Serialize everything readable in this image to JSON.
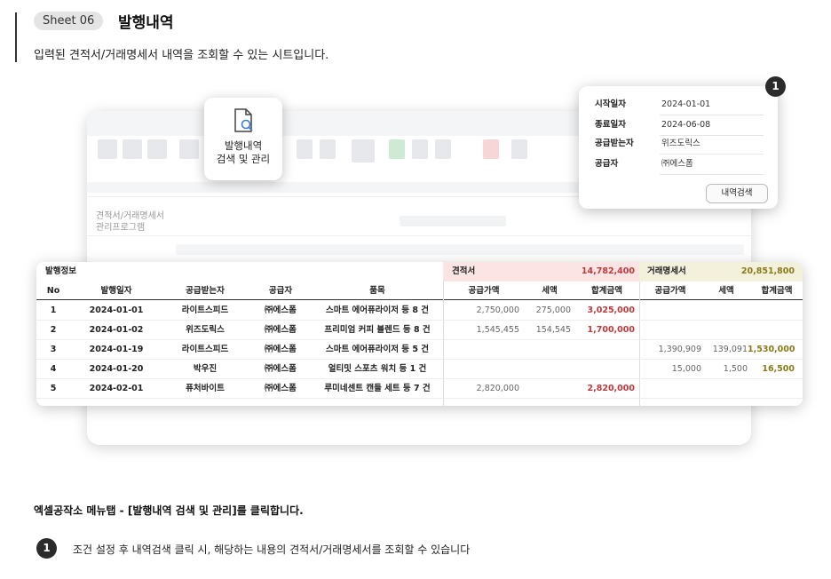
{
  "header": {
    "sheet_badge": "Sheet 06",
    "title": "발행내역",
    "subtitle": "입력된 견적서/거래명세서 내역을 조회할 수 있는 시트입니다."
  },
  "popup_button": {
    "line1": "발행내역",
    "line2": "검색 및 관리",
    "icon": "document-search-icon"
  },
  "search_card": {
    "badge": "1",
    "fields": [
      {
        "label": "시작일자",
        "value": "2024-01-01"
      },
      {
        "label": "종료일자",
        "value": "2024-06-08"
      },
      {
        "label": "공급받는자",
        "value": "위즈도릭스"
      },
      {
        "label": "공급자",
        "value": "㈜에스폼"
      }
    ],
    "button": "내역검색"
  },
  "background_app": {
    "program_title_line1": "견적서/거래명세서",
    "program_title_line2": "관리프로그램"
  },
  "table": {
    "section_title": "발행정보",
    "quote": {
      "label": "견적서",
      "total": "14,782,400"
    },
    "statement": {
      "label": "거래명세서",
      "total": "20,851,800"
    },
    "columns": [
      "No",
      "발행일자",
      "공급받는자",
      "공급자",
      "품목",
      "공급가액",
      "세액",
      "합계금액",
      "공급가액",
      "세액",
      "합계금액"
    ],
    "rows": [
      [
        "1",
        "2024-01-01",
        "라이트스피드",
        "㈜에스폼",
        "스마트 에어퓨라이저 등 8 건",
        "2,750,000",
        "275,000",
        "3,025,000",
        "",
        "",
        ""
      ],
      [
        "2",
        "2024-01-02",
        "위즈도릭스",
        "㈜에스폼",
        "프리미엄 커피 블렌드 등 8 건",
        "1,545,455",
        "154,545",
        "1,700,000",
        "",
        "",
        ""
      ],
      [
        "3",
        "2024-01-19",
        "라이트스피드",
        "㈜에스폼",
        "스마트 에어퓨라이저 등 5 건",
        "",
        "",
        "",
        "1,390,909",
        "139,091",
        "1,530,000"
      ],
      [
        "4",
        "2024-01-20",
        "박우진",
        "㈜에스폼",
        "얼티밋 스포츠 워치 등 1 건",
        "",
        "",
        "",
        "15,000",
        "1,500",
        "16,500"
      ],
      [
        "5",
        "2024-02-01",
        "퓨처바이트",
        "㈜에스폼",
        "루미네센트 캔들 세트 등 7 건",
        "2,820,000",
        "",
        "2,820,000",
        "",
        "",
        ""
      ]
    ]
  },
  "footer": {
    "instruction": "엑셀공작소 메뉴탭 - [발행내역 검색 및 관리]를 클릭합니다.",
    "step_badge": "1",
    "step_text": "조건 설정 후 내역검색 클릭 시, 해당하는 내용의 견적서/거래명세서를 조회할 수 있습니다"
  },
  "colors": {
    "quote_bg": "#fbe4e4",
    "statement_bg": "#f3f0dc",
    "accent_red": "#c0393b",
    "accent_olive": "#8a7a1a"
  }
}
